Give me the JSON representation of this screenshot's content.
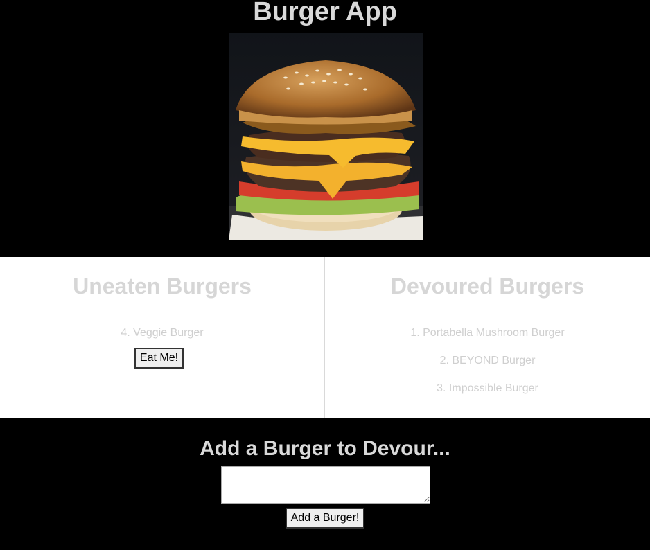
{
  "app": {
    "title": "Burger App"
  },
  "hero": {
    "image_label": "burger-photo"
  },
  "uneaten": {
    "heading": "Uneaten Burgers",
    "items": [
      "4. Veggie Burger"
    ],
    "button_label": "Eat Me!"
  },
  "devoured": {
    "heading": "Devoured Burgers",
    "items": [
      "1. Portabella Mushroom Burger",
      "2. BEYOND Burger",
      "3. Impossible Burger"
    ]
  },
  "add_form": {
    "title": "Add a Burger to Devour...",
    "input_value": "",
    "button_label": "Add a Burger!"
  },
  "colors": {
    "page_background": "#000000",
    "list_background": "#ffffff",
    "text_light": "#d9d9d9"
  }
}
